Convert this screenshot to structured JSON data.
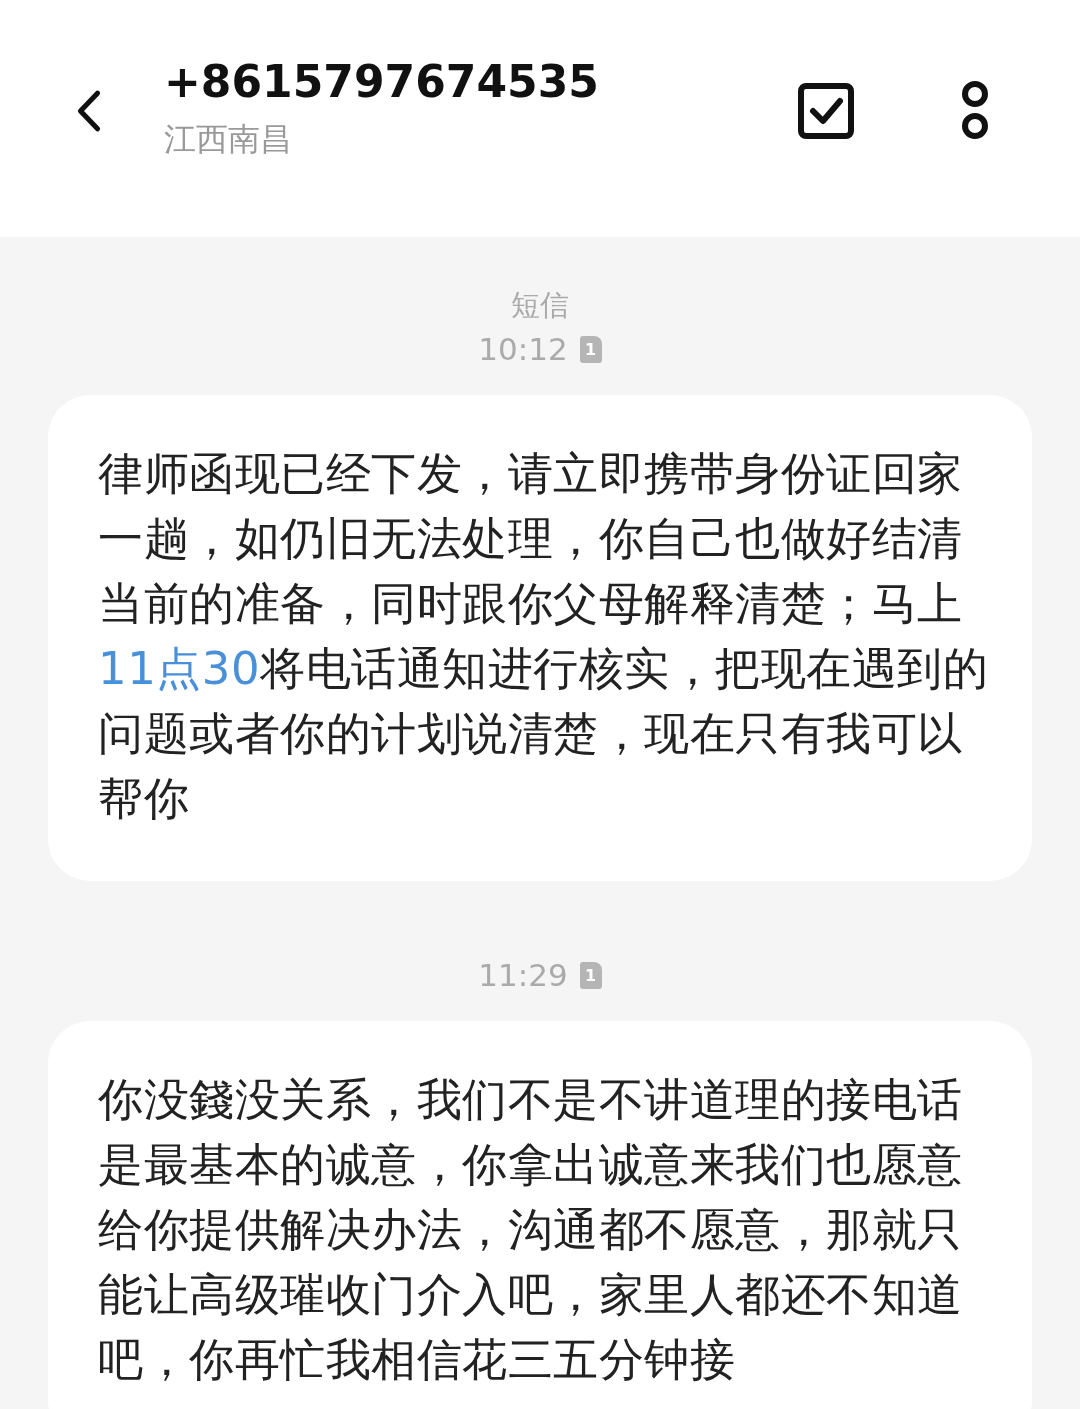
{
  "header": {
    "title": "+8615797674535",
    "subtitle": "江西南昌"
  },
  "messages": [
    {
      "label": "短信",
      "time": "10:12",
      "sim": "1",
      "segments": [
        {
          "kind": "text",
          "text": "律师函现已经下发，请立即携带身份证回家一趟，如仍旧无法处理，你自己也做好结清当前的准备，同时跟你父母解释清楚；马上"
        },
        {
          "kind": "link",
          "text": "11点30"
        },
        {
          "kind": "text",
          "text": "将电话通知进行核实，把现在遇到的问题或者你的计划说清楚，现在只有我可以帮你"
        }
      ]
    },
    {
      "time": "11:29",
      "sim": "1",
      "segments": [
        {
          "kind": "text",
          "text": "你没錢没关系，我们不是不讲道理的接电话是最基本的诚意，你拿出诚意来我们也愿意给你提供解决办法，沟通都不愿意，那就只能让高级璀收门介入吧，家里人都还不知道吧，你再忙我相信花三五分钟接"
        }
      ]
    }
  ]
}
